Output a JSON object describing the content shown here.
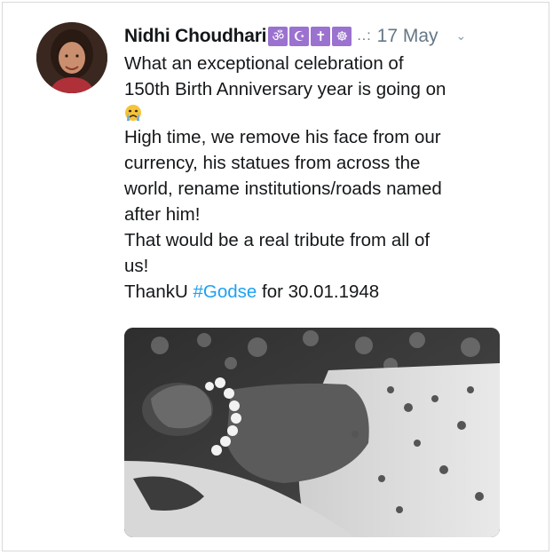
{
  "tweet": {
    "author_name": "Nidhi Choudhari",
    "badges": [
      "ॐ",
      "☪",
      "✝",
      "☸"
    ],
    "separator": "..:",
    "date": "17 May",
    "lines": {
      "l1": "What an exceptional celebration of",
      "l2": "150th Birth Anniversary year is going on",
      "l3": "High time, we remove his face from our",
      "l4": "currency, his statues from across the",
      "l5": "world, rename institutions/roads named",
      "l6": "after him!",
      "l7": "That would be a real tribute from all of",
      "l8": "us!",
      "l9_prefix": "ThankU ",
      "hashtag": "#Godse",
      "l9_suffix": " for 30.01.1948"
    }
  },
  "icons": {
    "menu": "chevron-down-icon",
    "emoji": "crying-face-emoji"
  },
  "colors": {
    "text": "#14171a",
    "muted": "#657786",
    "hashtag": "#1da1f2",
    "badge": "#9b72cf"
  }
}
